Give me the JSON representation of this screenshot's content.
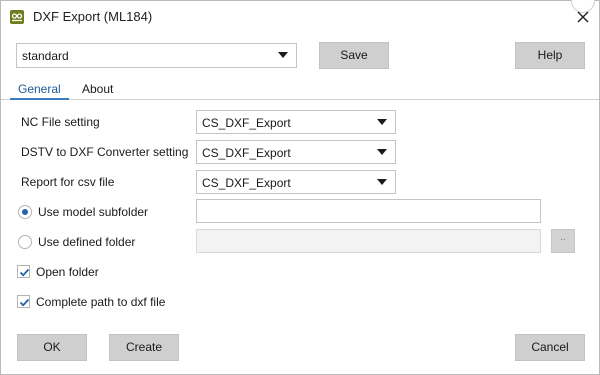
{
  "window": {
    "title": "DXF Export (ML184)",
    "app_icon": "oo-icon",
    "close_icon": "close-icon"
  },
  "toolbar": {
    "profile_value": "standard",
    "save_label": "Save",
    "help_label": "Help"
  },
  "tabs": [
    {
      "label": "General",
      "active": true
    },
    {
      "label": "About",
      "active": false
    }
  ],
  "settings": {
    "nc_file": {
      "label": "NC File setting",
      "value": "CS_DXF_Export"
    },
    "dstv": {
      "label": "DSTV to DXF Converter setting",
      "value": "CS_DXF_Export"
    },
    "report_csv": {
      "label": "Report for csv file",
      "value": "CS_DXF_Export"
    }
  },
  "folder": {
    "model_subfolder_label": "Use model subfolder",
    "model_subfolder_selected": true,
    "model_subfolder_value": "",
    "defined_folder_label": "Use defined folder",
    "defined_folder_selected": false,
    "defined_folder_value": "",
    "browse_label": ".."
  },
  "options": {
    "open_folder_label": "Open folder",
    "open_folder_checked": true,
    "complete_path_label": "Complete path to dxf file",
    "complete_path_checked": true
  },
  "footer": {
    "ok_label": "OK",
    "create_label": "Create",
    "cancel_label": "Cancel"
  },
  "colors": {
    "accent": "#1e63ad",
    "button_bg": "#cfcfcf",
    "app_icon_bg": "#6a7e1f"
  }
}
